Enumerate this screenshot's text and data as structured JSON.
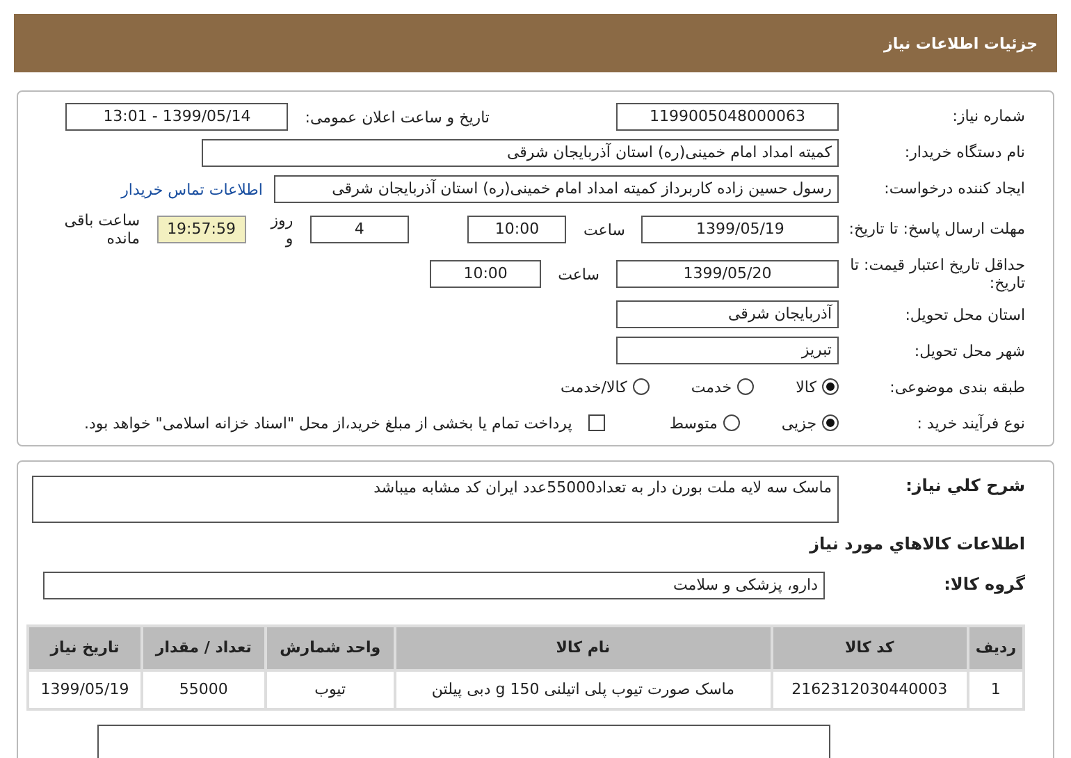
{
  "header": {
    "title": "جزئیات اطلاعات نیاز"
  },
  "need_number": {
    "label": "شماره نیاز:",
    "value": "1199005048000063"
  },
  "announce": {
    "label": "تاریخ و ساعت اعلان عمومی:",
    "value": "1399/05/14 - 13:01"
  },
  "buyer": {
    "label": "نام دستگاه خریدار:",
    "value": "کمیته امداد امام خمینی(ره) استان آذربایجان شرقی"
  },
  "creator": {
    "label": "ایجاد کننده درخواست:",
    "value": "رسول  حسین زاده  کاربرداز کمیته امداد امام خمینی(ره) استان آذربایجان شرقی",
    "link": "اطلاعات تماس خریدار"
  },
  "deadline": {
    "label": "مهلت ارسال پاسخ: تا تاریخ:",
    "date": "1399/05/19",
    "time_label": "ساعت",
    "time": "10:00",
    "days": "4",
    "days_label": "روز و",
    "remaining": "19:57:59",
    "remaining_label": "ساعت باقی مانده"
  },
  "validity": {
    "label": "حداقل تاریخ اعتبار قیمت: تا تاریخ:",
    "date": "1399/05/20",
    "time_label": "ساعت",
    "time": "10:00"
  },
  "province": {
    "label": "استان محل تحویل:",
    "value": "آذربایجان شرقی"
  },
  "city": {
    "label": "شهر محل تحویل:",
    "value": "تبریز"
  },
  "category": {
    "label": "طبقه بندی موضوعی:",
    "options": [
      {
        "label": "کالا",
        "selected": true
      },
      {
        "label": "خدمت",
        "selected": false
      },
      {
        "label": "کالا/خدمت",
        "selected": false
      }
    ]
  },
  "process": {
    "label": "نوع فرآیند خرید :",
    "options": [
      {
        "label": "جزیی",
        "selected": true
      },
      {
        "label": "متوسط",
        "selected": false
      }
    ],
    "treasury": {
      "label": "پرداخت تمام یا بخشی از مبلغ خرید،از محل \"اسناد خزانه اسلامی\" خواهد بود.",
      "checked": false
    }
  },
  "description": {
    "label": "شرح كلي نياز:",
    "value": "ماسک سه لایه ملت بورن دار به تعداد55000عدد ایران کد مشابه میباشد"
  },
  "goods_heading": "اطلاعات کالاهاي مورد نياز",
  "goods_group": {
    "label": "گروه کالا:",
    "value": "دارو، پزشکی و سلامت"
  },
  "table": {
    "columns": [
      "ردیف",
      "کد کالا",
      "نام کالا",
      "واحد شمارش",
      "تعداد / مقدار",
      "تاریخ نیاز"
    ],
    "rows": [
      [
        "1",
        "2162312030440003",
        "ماسک صورت تیوب پلی اتیلنی 150 g دبی پیلتن",
        "تیوب",
        "55000",
        "1399/05/19"
      ]
    ]
  }
}
